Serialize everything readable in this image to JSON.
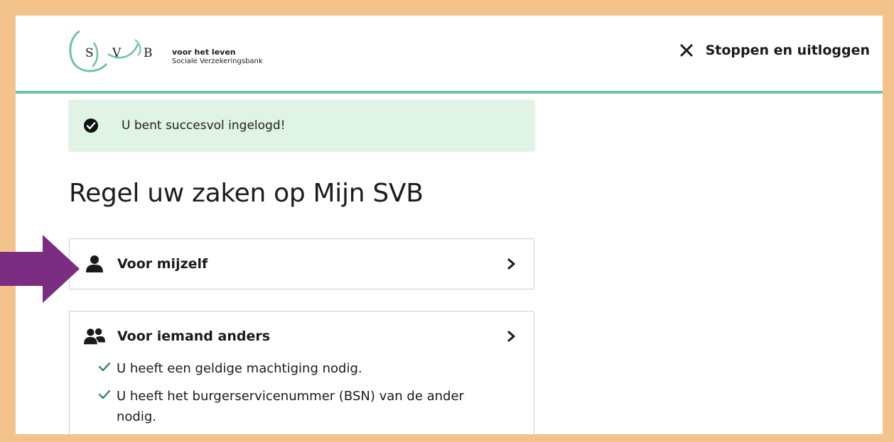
{
  "header": {
    "logo_letters": [
      "S",
      "V",
      "B"
    ],
    "logo_tagline": "voor het leven",
    "logo_subtitle": "Sociale Verzekeringsbank",
    "logout_label": "Stoppen en uitloggen",
    "logout_icon": "close-icon"
  },
  "alert": {
    "icon": "check-circle-icon",
    "message": "U bent succesvol ingelogd!"
  },
  "page": {
    "title": "Regel uw zaken op Mijn SVB"
  },
  "cards": [
    {
      "icon": "person-icon",
      "label": "Voor mijzelf"
    },
    {
      "icon": "people-icon",
      "label": "Voor iemand anders",
      "checks": [
        "U heeft een geldige machtiging nodig.",
        "U heeft het burgerservicenummer (BSN) van de ander nodig."
      ]
    }
  ],
  "colors": {
    "frame_background": "#f4c38c",
    "header_border": "#6cc2ac",
    "alert_background": "#dff4e4",
    "check_color": "#2c7a5e",
    "annotation_arrow": "#7b2d82"
  }
}
